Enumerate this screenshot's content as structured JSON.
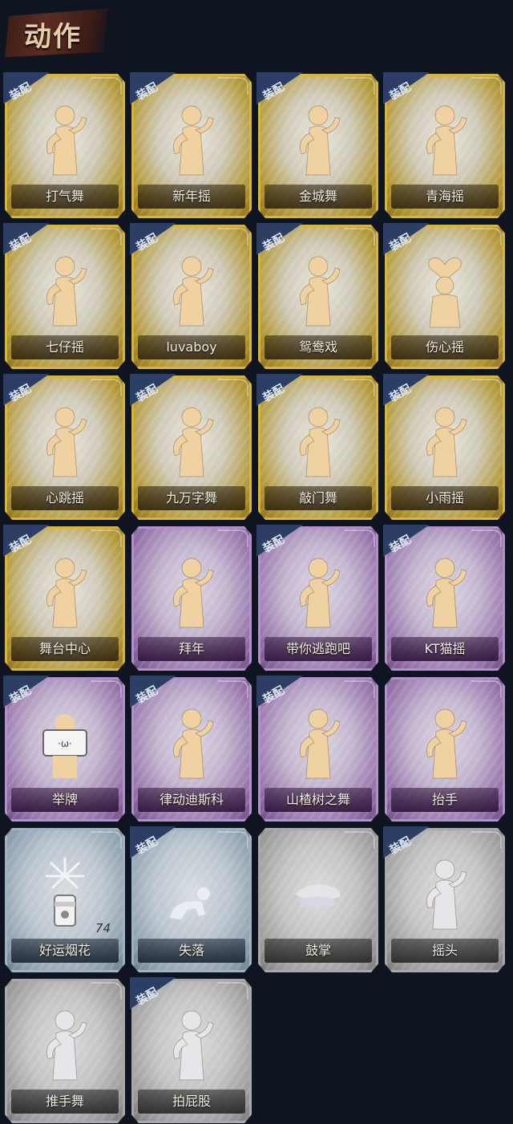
{
  "header": {
    "title": "动作"
  },
  "badge_label": "装配",
  "colors": {
    "gold": "#d7b43a",
    "purple": "#b38fcb",
    "blue": "#9fb3c4",
    "silver": "#a9a9a9",
    "background": "#0e1520",
    "badge": "#2c3e63"
  },
  "actions": [
    {
      "label": "打气舞",
      "rarity": "gold",
      "equipped": true,
      "icon": "dance-figure-icon"
    },
    {
      "label": "新年摇",
      "rarity": "gold",
      "equipped": true,
      "icon": "dance-figure-icon"
    },
    {
      "label": "金城舞",
      "rarity": "gold",
      "equipped": true,
      "icon": "dance-figure-icon"
    },
    {
      "label": "青海摇",
      "rarity": "gold",
      "equipped": true,
      "icon": "dance-figure-icon"
    },
    {
      "label": "七仔摇",
      "rarity": "gold",
      "equipped": true,
      "icon": "dance-figure-icon"
    },
    {
      "label": "luvaboy",
      "rarity": "gold",
      "equipped": true,
      "icon": "dance-figure-icon"
    },
    {
      "label": "鸳鸯戏",
      "rarity": "gold",
      "equipped": true,
      "icon": "dance-figure-icon"
    },
    {
      "label": "伤心摇",
      "rarity": "gold",
      "equipped": true,
      "icon": "heart-hands-figure-icon"
    },
    {
      "label": "心跳摇",
      "rarity": "gold",
      "equipped": true,
      "icon": "dance-figure-icon"
    },
    {
      "label": "九万字舞",
      "rarity": "gold",
      "equipped": true,
      "icon": "dance-figure-icon"
    },
    {
      "label": "敲门舞",
      "rarity": "gold",
      "equipped": true,
      "icon": "dance-figure-icon"
    },
    {
      "label": "小雨摇",
      "rarity": "gold",
      "equipped": true,
      "icon": "dance-figure-icon"
    },
    {
      "label": "舞台中心",
      "rarity": "gold",
      "equipped": true,
      "icon": "dance-figure-icon"
    },
    {
      "label": "拜年",
      "rarity": "purple",
      "equipped": false,
      "icon": "bow-figure-icon"
    },
    {
      "label": "带你逃跑吧",
      "rarity": "purple",
      "equipped": true,
      "icon": "dance-figure-icon"
    },
    {
      "label": "KT猫摇",
      "rarity": "purple",
      "equipped": true,
      "icon": "dance-figure-icon"
    },
    {
      "label": "举牌",
      "rarity": "purple",
      "equipped": true,
      "icon": "sign-figure-icon"
    },
    {
      "label": "律动迪斯科",
      "rarity": "purple",
      "equipped": true,
      "icon": "dance-figure-icon"
    },
    {
      "label": "山楂树之舞",
      "rarity": "purple",
      "equipped": true,
      "icon": "dance-figure-icon"
    },
    {
      "label": "抬手",
      "rarity": "purple",
      "equipped": false,
      "icon": "raise-hand-figure-icon"
    },
    {
      "label": "好运烟花",
      "rarity": "blue",
      "equipped": false,
      "icon": "firework-icon",
      "count": "74"
    },
    {
      "label": "失落",
      "rarity": "blue",
      "equipped": true,
      "icon": "crawl-figure-icon"
    },
    {
      "label": "鼓掌",
      "rarity": "silver",
      "equipped": false,
      "icon": "clap-hands-icon"
    },
    {
      "label": "摇头",
      "rarity": "silver",
      "equipped": true,
      "icon": "shake-head-figure-icon"
    },
    {
      "label": "推手舞",
      "rarity": "silver",
      "equipped": false,
      "icon": "push-hands-figure-icon"
    },
    {
      "label": "拍屁股",
      "rarity": "silver",
      "equipped": true,
      "icon": "slap-figure-icon"
    }
  ]
}
